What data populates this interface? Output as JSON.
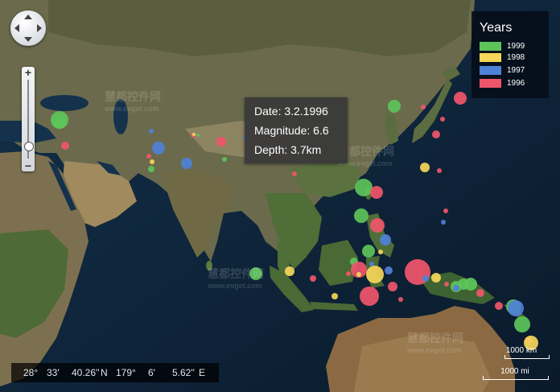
{
  "map": {
    "legend": {
      "title": "Years",
      "items": [
        {
          "label": "1999",
          "color": "#5dc45a"
        },
        {
          "label": "1998",
          "color": "#f5d65a"
        },
        {
          "label": "1997",
          "color": "#4f81d6"
        },
        {
          "label": "1996",
          "color": "#f0566a"
        }
      ]
    },
    "tooltip": {
      "date": "Date: 3.2.1996",
      "magnitude": "Magnitude: 6.6",
      "depth": "Depth: 3.7km"
    },
    "coordinates": {
      "lat_deg": "28°",
      "lat_min": "33'",
      "lat_sec": "40.26''",
      "lat_hemi": "N",
      "lon_deg": "179°",
      "lon_min": "6'",
      "lon_sec": "5.62''",
      "lon_hemi": "E"
    },
    "scale": {
      "km_label": "1000 km",
      "mi_label": "1000 mi"
    },
    "watermarks": [
      {
        "text": "慧都控件网",
        "sub": "www.evget.com"
      },
      {
        "text": "慧都控件网",
        "sub": "www.evget.com"
      },
      {
        "text": "慧都控件网",
        "sub": "www.evget.com"
      },
      {
        "text": "慧都控件网",
        "sub": "www.evget.com"
      }
    ],
    "colors": {
      "1999": "#5dc45a",
      "1998": "#f5d65a",
      "1997": "#4f81d6",
      "1996": "#f0566a"
    }
  }
}
